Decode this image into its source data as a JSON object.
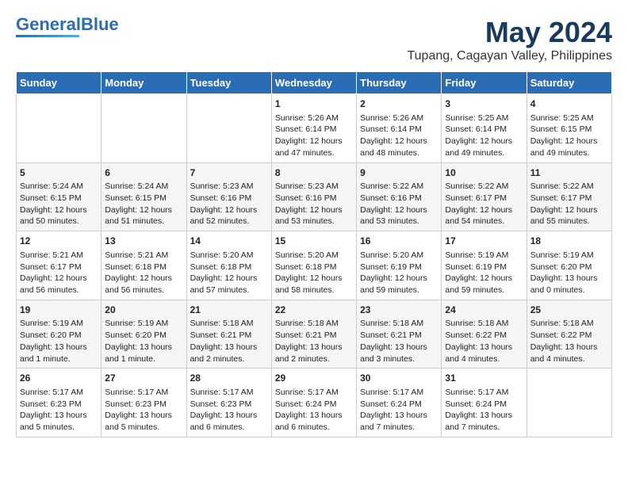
{
  "header": {
    "logo_general": "General",
    "logo_blue": "Blue",
    "month_year": "May 2024",
    "location": "Tupang, Cagayan Valley, Philippines"
  },
  "weekdays": [
    "Sunday",
    "Monday",
    "Tuesday",
    "Wednesday",
    "Thursday",
    "Friday",
    "Saturday"
  ],
  "weeks": [
    [
      {
        "day": "",
        "sunrise": "",
        "sunset": "",
        "daylight": ""
      },
      {
        "day": "",
        "sunrise": "",
        "sunset": "",
        "daylight": ""
      },
      {
        "day": "",
        "sunrise": "",
        "sunset": "",
        "daylight": ""
      },
      {
        "day": "1",
        "sunrise": "Sunrise: 5:26 AM",
        "sunset": "Sunset: 6:14 PM",
        "daylight": "Daylight: 12 hours and 47 minutes."
      },
      {
        "day": "2",
        "sunrise": "Sunrise: 5:26 AM",
        "sunset": "Sunset: 6:14 PM",
        "daylight": "Daylight: 12 hours and 48 minutes."
      },
      {
        "day": "3",
        "sunrise": "Sunrise: 5:25 AM",
        "sunset": "Sunset: 6:14 PM",
        "daylight": "Daylight: 12 hours and 49 minutes."
      },
      {
        "day": "4",
        "sunrise": "Sunrise: 5:25 AM",
        "sunset": "Sunset: 6:15 PM",
        "daylight": "Daylight: 12 hours and 49 minutes."
      }
    ],
    [
      {
        "day": "5",
        "sunrise": "Sunrise: 5:24 AM",
        "sunset": "Sunset: 6:15 PM",
        "daylight": "Daylight: 12 hours and 50 minutes."
      },
      {
        "day": "6",
        "sunrise": "Sunrise: 5:24 AM",
        "sunset": "Sunset: 6:15 PM",
        "daylight": "Daylight: 12 hours and 51 minutes."
      },
      {
        "day": "7",
        "sunrise": "Sunrise: 5:23 AM",
        "sunset": "Sunset: 6:16 PM",
        "daylight": "Daylight: 12 hours and 52 minutes."
      },
      {
        "day": "8",
        "sunrise": "Sunrise: 5:23 AM",
        "sunset": "Sunset: 6:16 PM",
        "daylight": "Daylight: 12 hours and 53 minutes."
      },
      {
        "day": "9",
        "sunrise": "Sunrise: 5:22 AM",
        "sunset": "Sunset: 6:16 PM",
        "daylight": "Daylight: 12 hours and 53 minutes."
      },
      {
        "day": "10",
        "sunrise": "Sunrise: 5:22 AM",
        "sunset": "Sunset: 6:17 PM",
        "daylight": "Daylight: 12 hours and 54 minutes."
      },
      {
        "day": "11",
        "sunrise": "Sunrise: 5:22 AM",
        "sunset": "Sunset: 6:17 PM",
        "daylight": "Daylight: 12 hours and 55 minutes."
      }
    ],
    [
      {
        "day": "12",
        "sunrise": "Sunrise: 5:21 AM",
        "sunset": "Sunset: 6:17 PM",
        "daylight": "Daylight: 12 hours and 56 minutes."
      },
      {
        "day": "13",
        "sunrise": "Sunrise: 5:21 AM",
        "sunset": "Sunset: 6:18 PM",
        "daylight": "Daylight: 12 hours and 56 minutes."
      },
      {
        "day": "14",
        "sunrise": "Sunrise: 5:20 AM",
        "sunset": "Sunset: 6:18 PM",
        "daylight": "Daylight: 12 hours and 57 minutes."
      },
      {
        "day": "15",
        "sunrise": "Sunrise: 5:20 AM",
        "sunset": "Sunset: 6:18 PM",
        "daylight": "Daylight: 12 hours and 58 minutes."
      },
      {
        "day": "16",
        "sunrise": "Sunrise: 5:20 AM",
        "sunset": "Sunset: 6:19 PM",
        "daylight": "Daylight: 12 hours and 59 minutes."
      },
      {
        "day": "17",
        "sunrise": "Sunrise: 5:19 AM",
        "sunset": "Sunset: 6:19 PM",
        "daylight": "Daylight: 12 hours and 59 minutes."
      },
      {
        "day": "18",
        "sunrise": "Sunrise: 5:19 AM",
        "sunset": "Sunset: 6:20 PM",
        "daylight": "Daylight: 13 hours and 0 minutes."
      }
    ],
    [
      {
        "day": "19",
        "sunrise": "Sunrise: 5:19 AM",
        "sunset": "Sunset: 6:20 PM",
        "daylight": "Daylight: 13 hours and 1 minute."
      },
      {
        "day": "20",
        "sunrise": "Sunrise: 5:19 AM",
        "sunset": "Sunset: 6:20 PM",
        "daylight": "Daylight: 13 hours and 1 minute."
      },
      {
        "day": "21",
        "sunrise": "Sunrise: 5:18 AM",
        "sunset": "Sunset: 6:21 PM",
        "daylight": "Daylight: 13 hours and 2 minutes."
      },
      {
        "day": "22",
        "sunrise": "Sunrise: 5:18 AM",
        "sunset": "Sunset: 6:21 PM",
        "daylight": "Daylight: 13 hours and 2 minutes."
      },
      {
        "day": "23",
        "sunrise": "Sunrise: 5:18 AM",
        "sunset": "Sunset: 6:21 PM",
        "daylight": "Daylight: 13 hours and 3 minutes."
      },
      {
        "day": "24",
        "sunrise": "Sunrise: 5:18 AM",
        "sunset": "Sunset: 6:22 PM",
        "daylight": "Daylight: 13 hours and 4 minutes."
      },
      {
        "day": "25",
        "sunrise": "Sunrise: 5:18 AM",
        "sunset": "Sunset: 6:22 PM",
        "daylight": "Daylight: 13 hours and 4 minutes."
      }
    ],
    [
      {
        "day": "26",
        "sunrise": "Sunrise: 5:17 AM",
        "sunset": "Sunset: 6:23 PM",
        "daylight": "Daylight: 13 hours and 5 minutes."
      },
      {
        "day": "27",
        "sunrise": "Sunrise: 5:17 AM",
        "sunset": "Sunset: 6:23 PM",
        "daylight": "Daylight: 13 hours and 5 minutes."
      },
      {
        "day": "28",
        "sunrise": "Sunrise: 5:17 AM",
        "sunset": "Sunset: 6:23 PM",
        "daylight": "Daylight: 13 hours and 6 minutes."
      },
      {
        "day": "29",
        "sunrise": "Sunrise: 5:17 AM",
        "sunset": "Sunset: 6:24 PM",
        "daylight": "Daylight: 13 hours and 6 minutes."
      },
      {
        "day": "30",
        "sunrise": "Sunrise: 5:17 AM",
        "sunset": "Sunset: 6:24 PM",
        "daylight": "Daylight: 13 hours and 7 minutes."
      },
      {
        "day": "31",
        "sunrise": "Sunrise: 5:17 AM",
        "sunset": "Sunset: 6:24 PM",
        "daylight": "Daylight: 13 hours and 7 minutes."
      },
      {
        "day": "",
        "sunrise": "",
        "sunset": "",
        "daylight": ""
      }
    ]
  ]
}
